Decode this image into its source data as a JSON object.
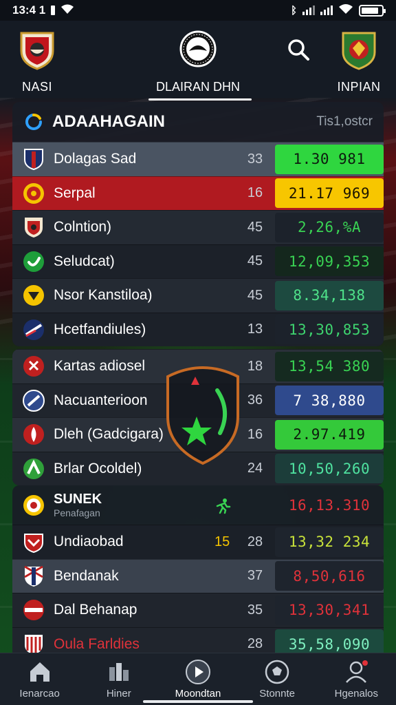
{
  "status": {
    "time": "13:4 1",
    "battery_level": 0.85
  },
  "header": {
    "left_team": "NASI",
    "center_tab": "DLAIRAN DHN",
    "right_team": "INPIAN"
  },
  "panel1": {
    "title": "ADAAHAGAIN",
    "subtitle": "Tis1,ostcr",
    "rows": [
      {
        "name": "Dolagas Sad",
        "num": "33",
        "value": "1.30 981",
        "value_color": "#2fd63f",
        "value_text_color": "#0d1a0f"
      },
      {
        "name": "Serpal",
        "num": "16",
        "value": "21.17 969",
        "value_color": "#f7c600",
        "value_text_color": "#1a1400"
      },
      {
        "name": "Colntion)",
        "num": "45",
        "value": "2,26,%A",
        "value_color": "#1c222b",
        "value_text_color": "#39d353"
      },
      {
        "name": "Seludcat)",
        "num": "45",
        "value": "12,09,353",
        "value_color": "#14271d",
        "value_text_color": "#39d353"
      },
      {
        "name": "Nsor Kanstiloa)",
        "num": "45",
        "value": "8.34,138",
        "value_color": "#1d4a40",
        "value_text_color": "#4fe28a"
      },
      {
        "name": "Hcetfandiules)",
        "num": "13",
        "value": "13,30,853",
        "value_color": "#1c222b",
        "value_text_color": "#3ed46f"
      }
    ]
  },
  "panel2": {
    "rows": [
      {
        "name": "Kartas adiosel",
        "num": "18",
        "value": "13,54 380",
        "value_color": "#152a20",
        "value_text_color": "#39d353"
      },
      {
        "name": "Nacuanterioon",
        "num": "36",
        "value": "7 38,880",
        "value_color": "#2f4a8d",
        "value_text_color": "#ffffff"
      },
      {
        "name": "Dleh (Gadcigara)",
        "num": "16",
        "value": "2.97.419",
        "value_color": "#34c93a",
        "value_text_color": "#0e1b0e"
      },
      {
        "name": "Brlar Ocoldel)",
        "num": "24",
        "value": "10,50,260",
        "value_color": "#1c3d3a",
        "value_text_color": "#4fe2a0"
      }
    ]
  },
  "panel3": {
    "title": "SUNEK",
    "subtitle": "Penafagan",
    "header_value": "16,13.310",
    "rows": [
      {
        "name": "Undiaobad",
        "small": "15",
        "num": "28",
        "value": "13,32 234",
        "value_color": "#1e242d",
        "value_text_color": "#c8e23a"
      },
      {
        "name": "Bendanak",
        "num": "37",
        "value": "8,50,616",
        "value_color": "#1e242d",
        "value_text_color": "#e0323a"
      },
      {
        "name": "Dal Behanap",
        "num": "35",
        "value": "13,30,341",
        "value_color": "#1e242d",
        "value_text_color": "#e0323a"
      },
      {
        "name": "Oula Farldies",
        "num": "28",
        "value": "35,58,090",
        "value_color": "#1c4a3e",
        "value_text_color": "#7ff0c0"
      }
    ]
  },
  "bottom_nav": [
    {
      "label": "Ienarcao",
      "icon": "home-icon"
    },
    {
      "label": "Hiner",
      "icon": "stats-icon"
    },
    {
      "label": "Moondtan",
      "icon": "play-icon"
    },
    {
      "label": "Stonnte",
      "icon": "ball-icon"
    },
    {
      "label": "Hgenalos",
      "icon": "profile-icon"
    }
  ]
}
